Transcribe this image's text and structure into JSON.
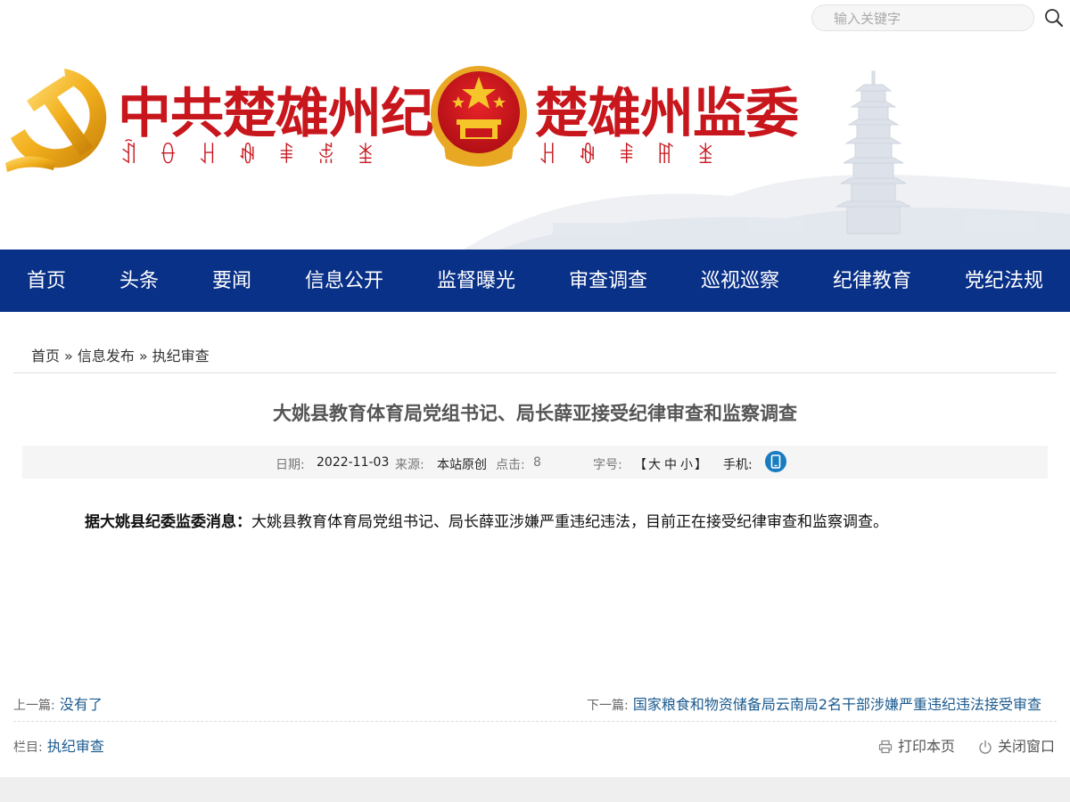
{
  "search": {
    "placeholder": "输入关键字"
  },
  "banner": {
    "left_title": "中共楚雄州纪委",
    "left_subtitle": "ꀉꂷꃅꊿꑌꅇꁧ",
    "right_title": "楚雄州监委",
    "right_subtitle": "ꃅꊿꑌꂵꁧ"
  },
  "nav": {
    "items": [
      {
        "label": "首页"
      },
      {
        "label": "头条"
      },
      {
        "label": "要闻"
      },
      {
        "label": "信息公开"
      },
      {
        "label": "监督曝光"
      },
      {
        "label": "审查调查"
      },
      {
        "label": "巡视巡察"
      },
      {
        "label": "纪律教育"
      },
      {
        "label": "党纪法规"
      }
    ]
  },
  "breadcrumb": {
    "items": [
      "首页",
      "信息发布",
      "执纪审查"
    ],
    "separator": "»"
  },
  "article": {
    "title": "大姚县教育体育局党组书记、局长薛亚接受纪律审查和监察调查",
    "meta": {
      "date_label": "日期:",
      "date": "2022-11-03",
      "source_label": "来源:",
      "source": "本站原创",
      "clicks_label": "点击:",
      "clicks": "8",
      "fontsize_label": "字号:",
      "fontsize_open": "【",
      "fontsize_large": "大",
      "fontsize_medium": "中",
      "fontsize_small": "小",
      "fontsize_close": "】",
      "mobile_label": "手机:"
    },
    "body_lead": "据大姚县纪委监委消息：",
    "body_text": "大姚县教育体育局党组书记、局长薛亚涉嫌严重违纪违法，目前正在接受纪律审查和监察调查。"
  },
  "pager": {
    "prev_label": "上一篇:",
    "prev_title": "没有了",
    "next_label": "下一篇:",
    "next_title": "国家粮食和物资储备局云南局2名干部涉嫌严重违纪违法接受审查",
    "column_label": "栏目:",
    "column_value": "执纪审查",
    "print_label": "打印本页",
    "close_label": "关闭窗口"
  },
  "colors": {
    "nav_bg": "#0a3188",
    "brand_red": "#c8161d",
    "link_blue": "#1b5b8f"
  }
}
